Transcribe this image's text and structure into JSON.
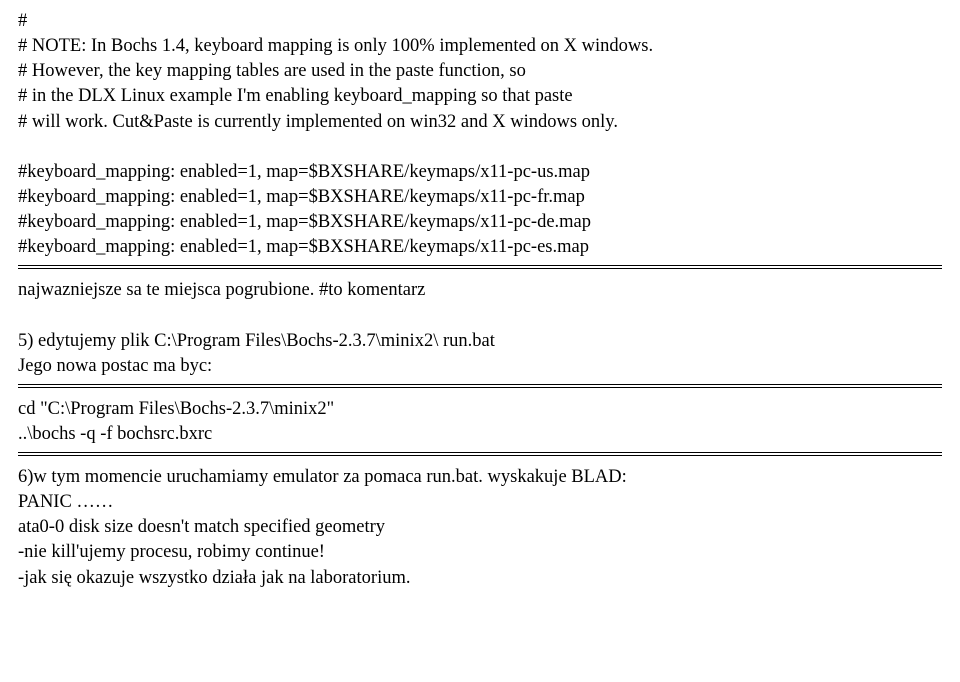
{
  "block1": {
    "l1": "#",
    "l2": "# NOTE: In Bochs 1.4, keyboard mapping is only 100% implemented on X windows.",
    "l3": "# However, the key mapping tables are used in the paste function, so",
    "l4": "# in the DLX Linux example I'm enabling keyboard_mapping so that paste",
    "l5": "# will work. Cut&Paste is currently implemented on win32 and X windows only.",
    "blank1": " ",
    "l6": "#keyboard_mapping: enabled=1, map=$BXSHARE/keymaps/x11-pc-us.map",
    "l7": "#keyboard_mapping: enabled=1, map=$BXSHARE/keymaps/x11-pc-fr.map",
    "l8": "#keyboard_mapping: enabled=1, map=$BXSHARE/keymaps/x11-pc-de.map",
    "l9": "#keyboard_mapping: enabled=1, map=$BXSHARE/keymaps/x11-pc-es.map"
  },
  "block2": {
    "l1": "najwazniejsze sa te miejsca pogrubione. #to komentarz",
    "blank1": " ",
    "l2": "5) edytujemy plik C:\\Program Files\\Bochs-2.3.7\\minix2\\ run.bat",
    "l3": "Jego nowa postac ma byc:"
  },
  "block3": {
    "l1": "cd \"C:\\Program Files\\Bochs-2.3.7\\minix2\"",
    "l2": "..\\bochs -q -f bochsrc.bxrc"
  },
  "block4": {
    "l1": "6)w tym momencie uruchamiamy emulator za pomaca run.bat. wyskakuje BLAD:",
    "l2": "PANIC ……",
    "l3": "ata0-0 disk size doesn't match specified geometry",
    "l4": "-nie kill'ujemy procesu, robimy continue!",
    "l5": "-jak się okazuje wszystko działa jak na laboratorium."
  }
}
